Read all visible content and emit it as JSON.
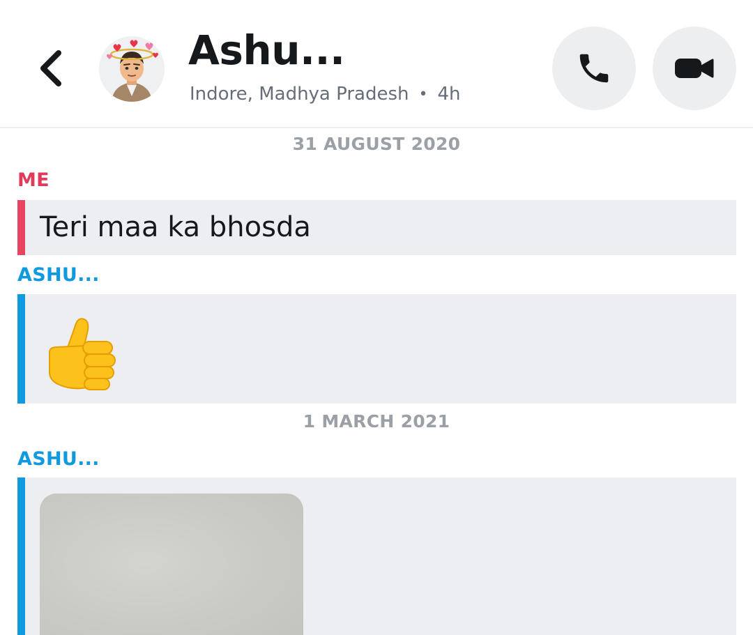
{
  "header": {
    "contact_name": "Ashu...",
    "location": "Indore, Madhya Pradesh",
    "separator": "•",
    "last_seen": "4h"
  },
  "icons": {
    "back": "chevron-left-icon",
    "call": "phone-icon",
    "video": "video-camera-icon"
  },
  "colors": {
    "me_accent": "#e84462",
    "friend_accent": "#0f9ae0",
    "bubble_bg": "#eceef1",
    "date_text": "#9aa0a6"
  },
  "conversation": {
    "sections": [
      {
        "date": "31 AUGUST 2020",
        "messages": [
          {
            "sender": "ME",
            "text": "Teri maa ka bhosda"
          },
          {
            "sender": "ASHU...",
            "emoji": "thumbs-up"
          }
        ]
      },
      {
        "date": "1 MARCH 2021",
        "messages": [
          {
            "sender": "ASHU...",
            "media": "photo"
          }
        ]
      }
    ]
  }
}
